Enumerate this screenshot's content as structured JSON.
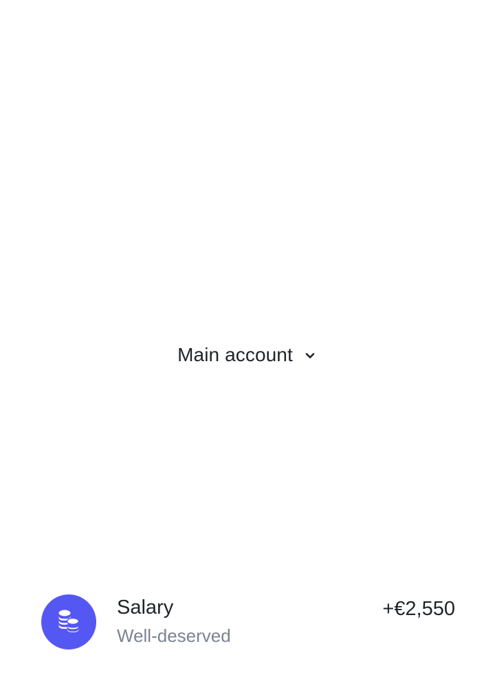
{
  "account_selector": {
    "label": "Main account",
    "icon": "chevron-down-icon"
  },
  "transactions": [
    {
      "title": "Salary",
      "subtitle": "Well-deserved",
      "amount": "+€2,550",
      "icon": "coins-icon",
      "icon_bg": "#5557f2"
    }
  ],
  "colors": {
    "text_primary": "#1f2328",
    "text_secondary": "#7b8492",
    "accent": "#5557f2",
    "background": "#ffffff"
  }
}
